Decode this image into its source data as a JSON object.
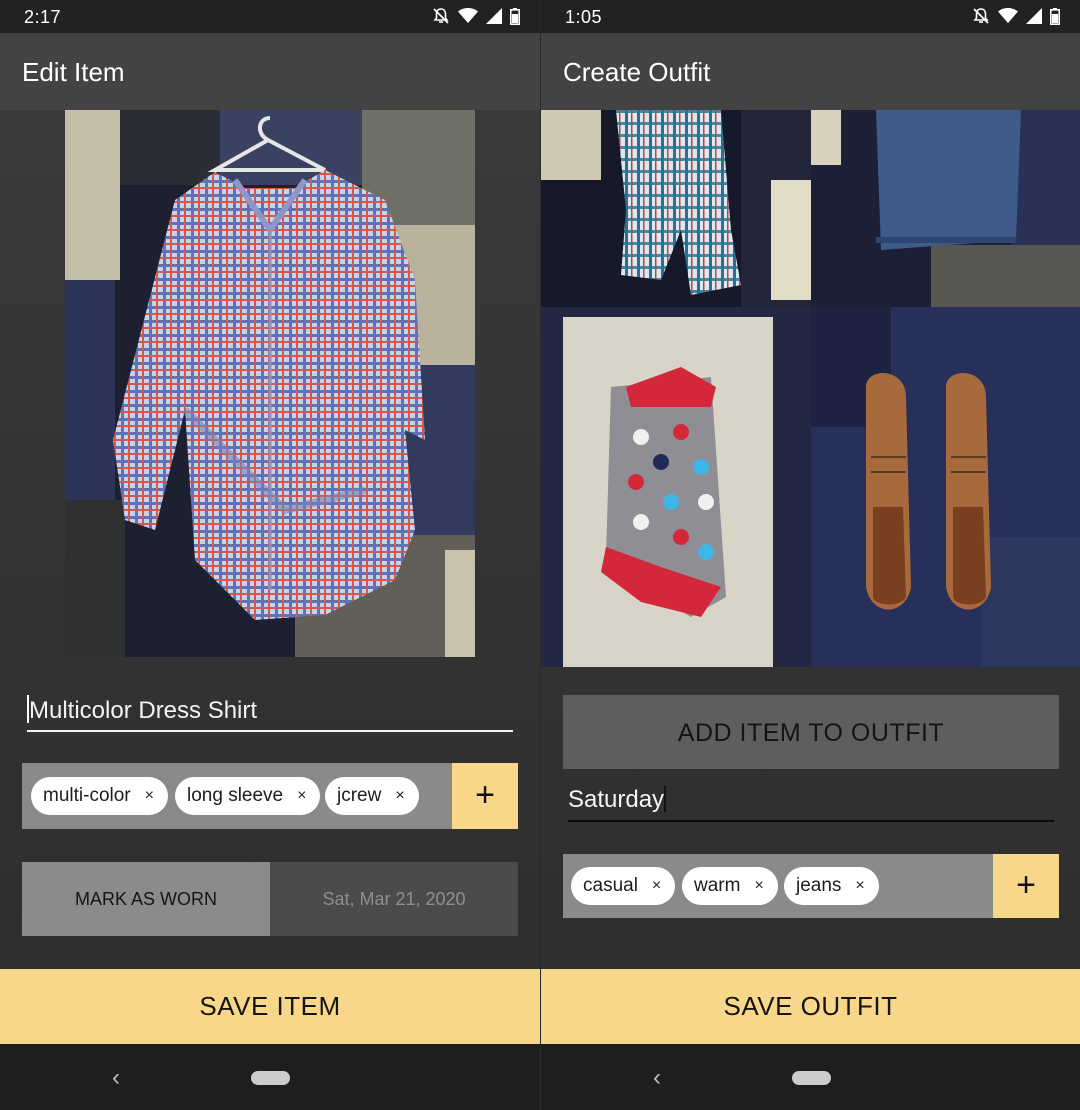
{
  "left": {
    "status": {
      "time": "2:17"
    },
    "appbar_title": "Edit Item",
    "name_value": "Multicolor Dress Shirt",
    "tags": [
      "multi-color",
      "long sleeve",
      "jcrew"
    ],
    "chip_remove": "×",
    "add_symbol": "+",
    "mark_worn_label": "MARK AS WORN",
    "date_value": "Sat, Mar 21, 2020",
    "save_label": "SAVE ITEM"
  },
  "right": {
    "status": {
      "time": "1:05"
    },
    "appbar_title": "Create Outfit",
    "add_item_label": "ADD ITEM TO OUTFIT",
    "outfit_name": "Saturday",
    "tags": [
      "casual",
      "warm",
      "jeans"
    ],
    "chip_remove": "×",
    "add_symbol": "+",
    "save_label": "SAVE OUTFIT"
  },
  "nav": {
    "back_symbol": "‹"
  },
  "icons": [
    "bell-off-icon",
    "wifi-icon",
    "signal-icon",
    "battery-icon",
    "back-icon",
    "home-pill-icon",
    "plus-icon",
    "close-icon"
  ],
  "colors": {
    "accent": "#f8d68a",
    "appbar": "#434343",
    "background": "#353535",
    "tagbar": "#8a8a8a"
  }
}
